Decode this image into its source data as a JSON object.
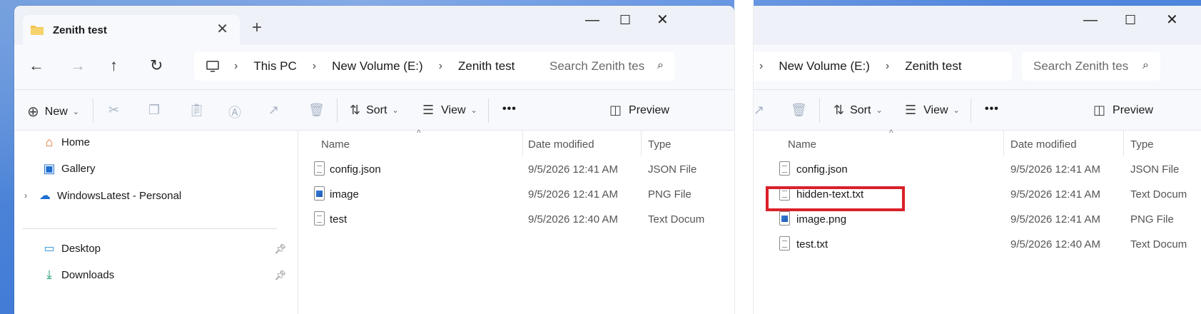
{
  "left_window": {
    "tab_title": "Zenith test",
    "breadcrumb": [
      "This PC",
      "New Volume (E:)",
      "Zenith test"
    ],
    "search_placeholder": "Search Zenith tes",
    "commands": {
      "new": "New",
      "sort": "Sort",
      "view": "View",
      "more": "•••",
      "preview": "Preview"
    },
    "nav": {
      "home": "Home",
      "gallery": "Gallery",
      "onedrive": "WindowsLatest - Personal",
      "desktop": "Desktop",
      "downloads": "Downloads"
    },
    "columns": {
      "name": "Name",
      "date": "Date modified",
      "type": "Type"
    },
    "files": [
      {
        "name": "config.json",
        "date": "9/5/2026 12:41 AM",
        "type": "JSON File",
        "icon": "doc"
      },
      {
        "name": "image",
        "date": "9/5/2026 12:41 AM",
        "type": "PNG File",
        "icon": "img"
      },
      {
        "name": "test",
        "date": "9/5/2026 12:40 AM",
        "type": "Text Docum",
        "icon": "doc"
      }
    ]
  },
  "right_window": {
    "breadcrumb": [
      "New Volume (E:)",
      "Zenith test"
    ],
    "search_placeholder": "Search Zenith tes",
    "commands": {
      "sort": "Sort",
      "view": "View",
      "more": "•••",
      "preview": "Preview"
    },
    "columns": {
      "name": "Name",
      "date": "Date modified",
      "type": "Type"
    },
    "files": [
      {
        "name": "config.json",
        "date": "9/5/2026 12:41 AM",
        "type": "JSON File",
        "icon": "doc"
      },
      {
        "name": "hidden-text.txt",
        "date": "9/5/2026 12:41 AM",
        "type": "Text Docum",
        "icon": "doc"
      },
      {
        "name": "image.png",
        "date": "9/5/2026 12:41 AM",
        "type": "PNG File",
        "icon": "img"
      },
      {
        "name": "test.txt",
        "date": "9/5/2026 12:40 AM",
        "type": "Text Docum",
        "icon": "doc"
      }
    ]
  },
  "colors": {
    "highlight": "#d9202a",
    "folder": "#f2c14e",
    "accent": "#1f6fd1"
  }
}
